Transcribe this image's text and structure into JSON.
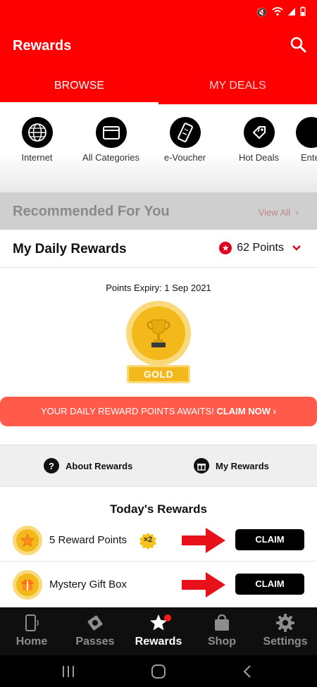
{
  "app": {
    "title": "Rewards"
  },
  "tabs": [
    {
      "label": "BROWSE",
      "active": true
    },
    {
      "label": "MY DEALS",
      "active": false
    }
  ],
  "categories": [
    {
      "label": "Internet",
      "icon": "globe-icon"
    },
    {
      "label": "All Categories",
      "icon": "folder-icon"
    },
    {
      "label": "e-Voucher",
      "icon": "ticket-icon"
    },
    {
      "label": "Hot Deals",
      "icon": "tag-icon"
    },
    {
      "label": "Ente",
      "icon": "entertainment-icon"
    }
  ],
  "recommended": {
    "title": "Recommended For You",
    "view_all": "View All"
  },
  "daily": {
    "title": "My Daily Rewards",
    "points": "62 Points",
    "expiry": "Points Expiry: 1 Sep 2021",
    "tier": "GOLD",
    "banner_text": "YOUR DAILY REWARD POINTS AWAITS! ",
    "banner_cta": "CLAIM NOW"
  },
  "links": {
    "about": "About Rewards",
    "my_rewards": "My Rewards"
  },
  "todays": {
    "title": "Today's Rewards",
    "items": [
      {
        "name": "5 Reward Points",
        "multiplier": "×2",
        "button": "CLAIM",
        "icon": "star-coin-icon"
      },
      {
        "name": "Mystery Gift Box",
        "button": "CLAIM",
        "icon": "gift-coin-icon"
      }
    ]
  },
  "bottom_nav": [
    {
      "label": "Home",
      "icon": "phone-icon",
      "active": false
    },
    {
      "label": "Passes",
      "icon": "pass-icon",
      "active": false
    },
    {
      "label": "Rewards",
      "icon": "star-icon",
      "active": true
    },
    {
      "label": "Shop",
      "icon": "bag-icon",
      "active": false
    },
    {
      "label": "Settings",
      "icon": "gear-icon",
      "active": false
    }
  ],
  "colors": {
    "brand": "#ff0000",
    "banner": "#ff5a4a",
    "gold": "#f3b81a"
  }
}
